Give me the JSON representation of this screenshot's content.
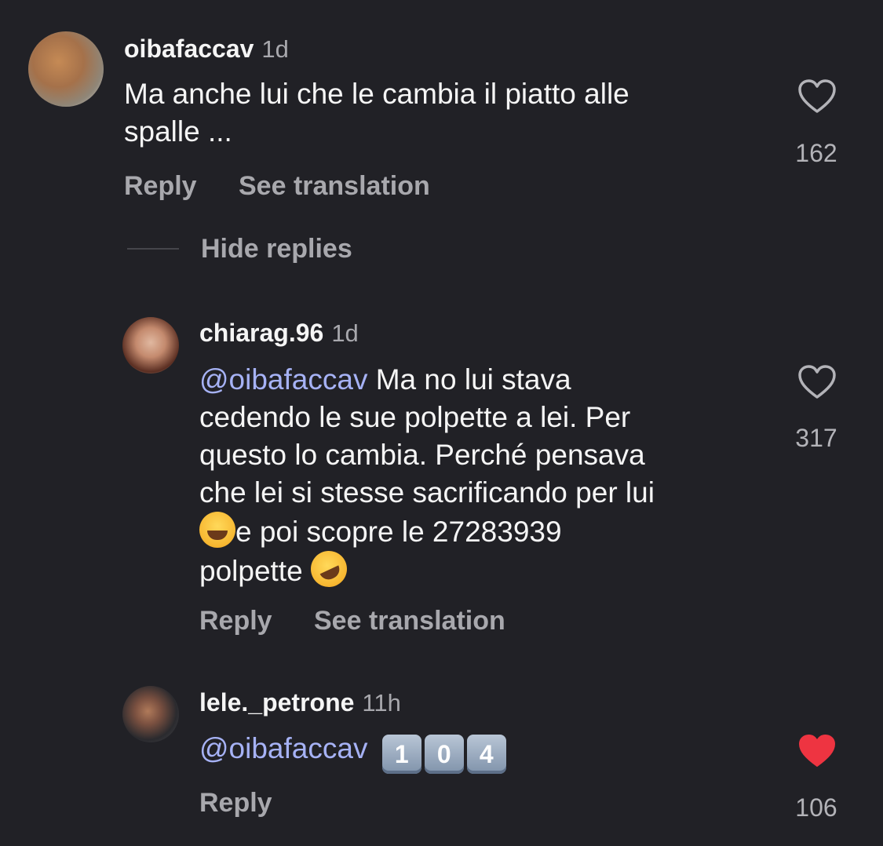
{
  "comments": [
    {
      "username": "oibafaccav",
      "time": "1d",
      "text_line1": "Ma anche lui che le cambia il piatto alle",
      "text_line2": "spalle ...",
      "reply_label": "Reply",
      "translate_label": "See translation",
      "likes": "162",
      "liked": false,
      "avatar_color": "#9a8f7e"
    },
    {
      "username": "chiarag.96",
      "time": "1d",
      "mention": "@oibafaccav",
      "line1": " Ma no lui stava",
      "line2": "cedendo le sue polpette a lei. Per",
      "line3": "questo lo cambia. Perché pensava",
      "line4": "che lei si stesse sacrificando per lui",
      "line5": "e poi scopre le 27283939",
      "line6": "polpette ",
      "emoji1": "face-with-tears-of-joy",
      "emoji2": "rolling-on-the-floor-laughing",
      "reply_label": "Reply",
      "translate_label": "See translation",
      "likes": "317",
      "liked": false,
      "avatar_color": "#7a4a3a"
    },
    {
      "username": "lele._petrone",
      "time": "11h",
      "mention": "@oibafaccav",
      "keycaps": [
        "1",
        "0",
        "4"
      ],
      "reply_label": "Reply",
      "likes": "106",
      "liked": true,
      "avatar_color": "#3b3b40"
    }
  ],
  "hide_replies_label": "Hide replies",
  "colors": {
    "background": "#212126",
    "mention": "#a6b2f5",
    "heart_liked": "#ee3441",
    "secondary_text": "#a8a8ad"
  }
}
